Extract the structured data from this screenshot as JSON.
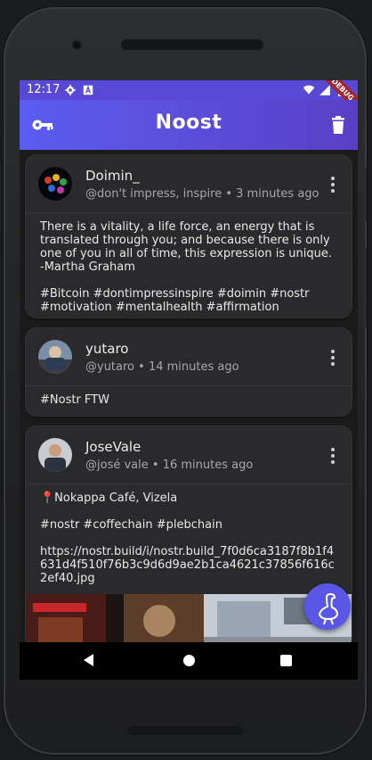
{
  "status": {
    "time": "12:17",
    "debug_label": "DEBUG"
  },
  "app": {
    "title": "Noost"
  },
  "posts": [
    {
      "name": "Doimin_",
      "handle": "@don't impress, inspire",
      "time": "3 minutes ago",
      "content": "There is a vitality, a life force, an energy that is translated through you; and because there is only one of you in all of time, this expression is unique.\n-Martha Graham\n\n#Bitcoin #dontimpressinspire #doimin #nostr #motivation #mentalhealth #affirmation"
    },
    {
      "name": "yutaro",
      "handle": "@yutaro",
      "time": "14 minutes ago",
      "content": "#Nostr FTW"
    },
    {
      "name": "JoseVale",
      "handle": "@josé vale",
      "time": "16 minutes ago",
      "content": "📍Nokappa Café, Vizela\n\n#nostr #coffechain #plebchain\n\nhttps://nostr.build/i/nostr.build_7f0d6ca3187f8b1f4631d4f510f76b3c9d6d9ae2b1ca4621c37856f616c2ef40.jpg"
    }
  ],
  "separator": "•",
  "colors": {
    "accent": "#5b57e6",
    "appbar_start": "#5a5cf1",
    "appbar_end": "#5a3fc6",
    "card": "#2a2a2c"
  },
  "icons": {
    "appbar_left": "key-icon",
    "appbar_right": "trash-icon",
    "fab": "ostrich-icon"
  }
}
